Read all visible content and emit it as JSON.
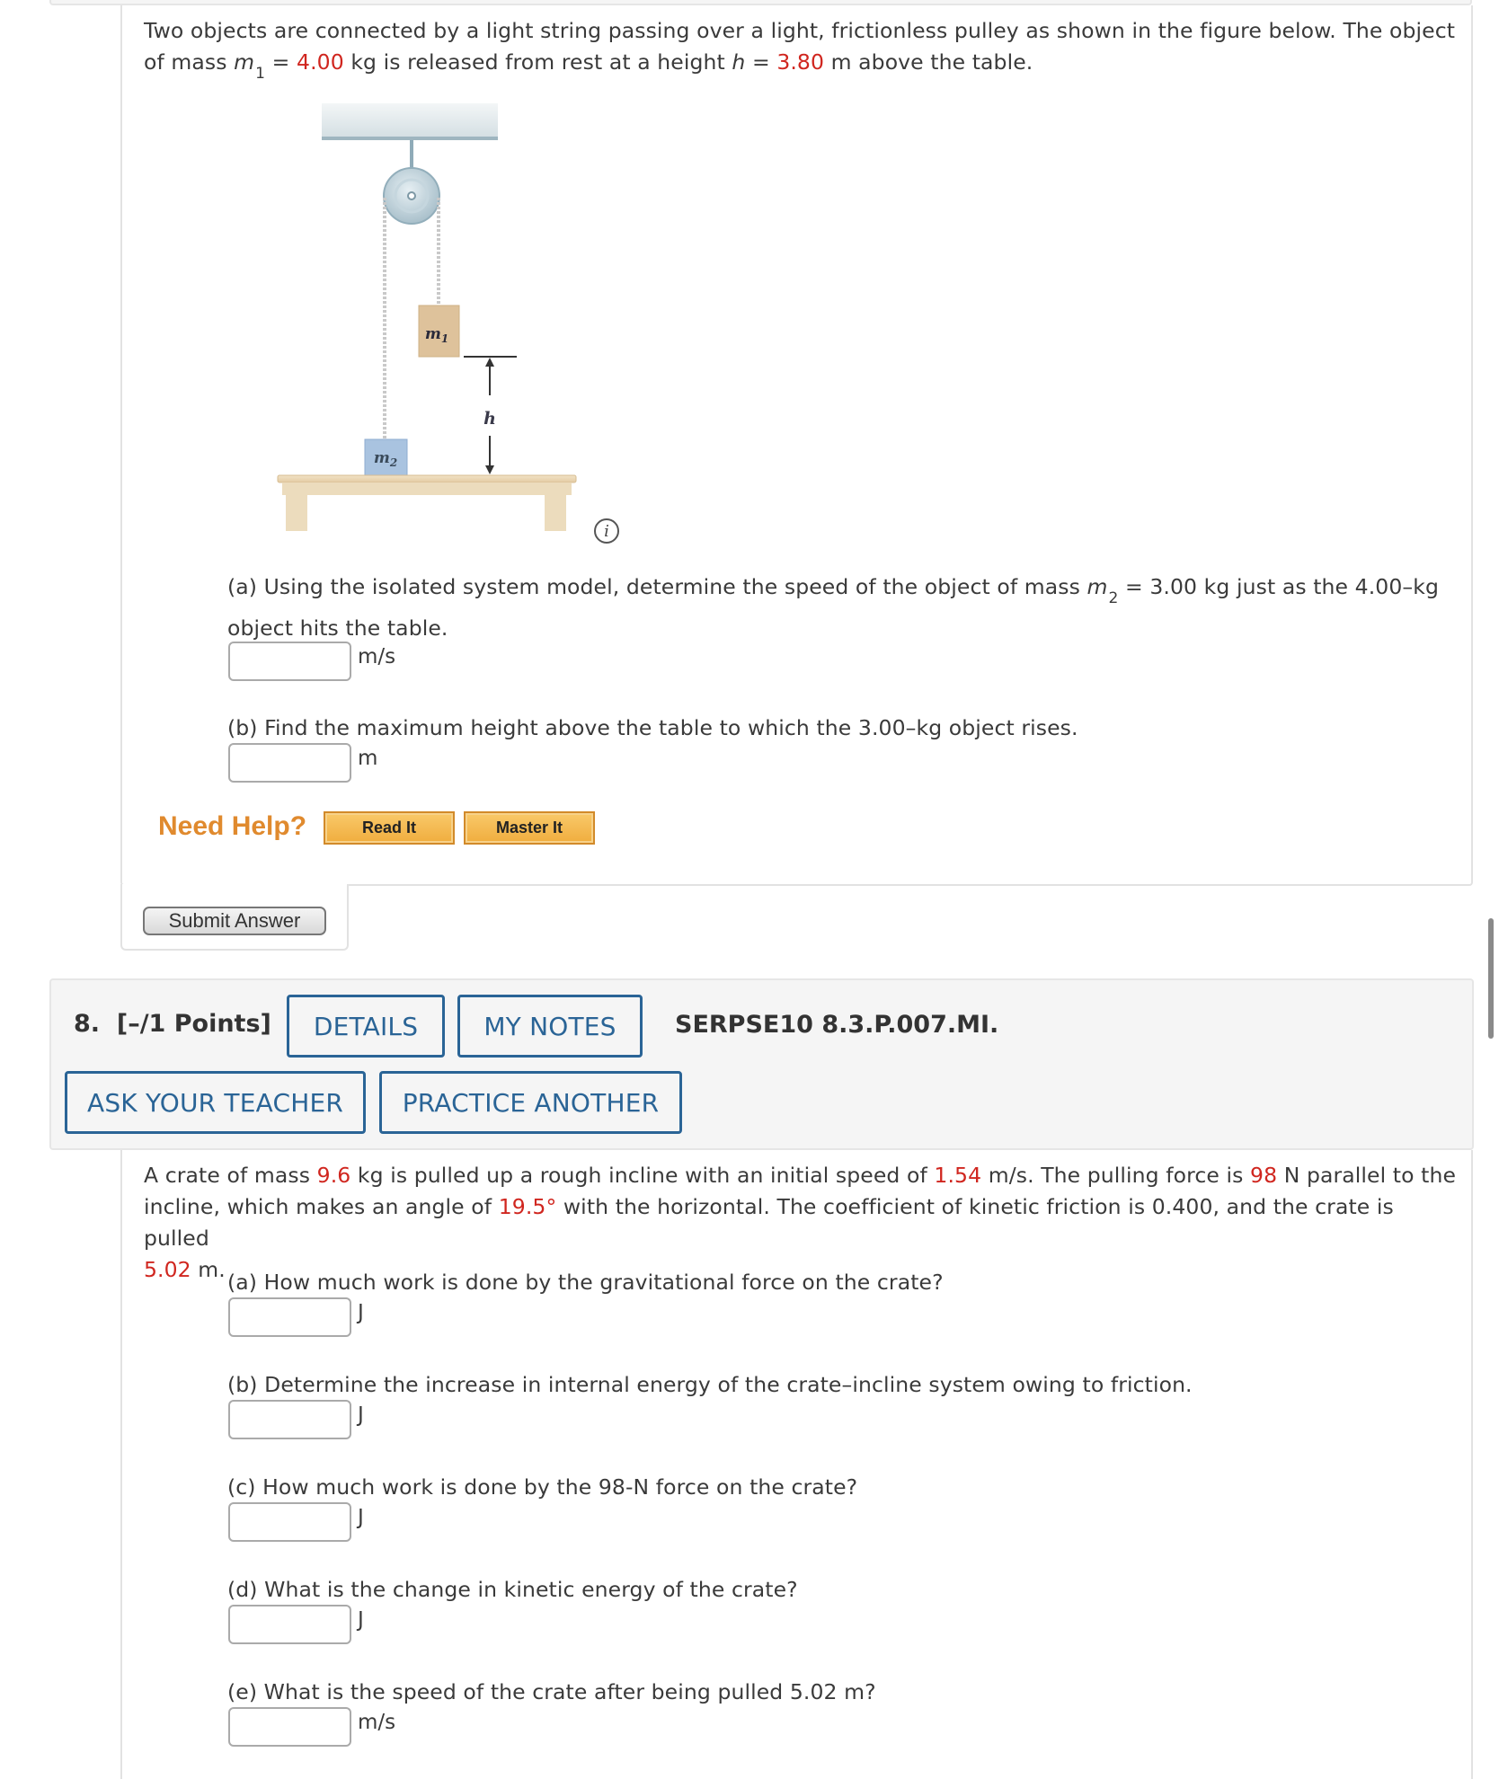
{
  "question7": {
    "intro": {
      "p1": "Two objects are connected by a light string passing over a light, frictionless pulley as shown in the figure below. The object",
      "p2_a": "of mass ",
      "m1_var": "m",
      "m1_sub": "1",
      "p2_b": " = ",
      "m1_value": "4.00",
      "p2_c": " kg is released from rest at a height ",
      "h_var": "h",
      "p2_d": " = ",
      "h_value": "3.80",
      "p2_e": " m above the table."
    },
    "figure": {
      "m1_label": "m",
      "m1_sub": "1",
      "m2_label": "m",
      "m2_sub": "2",
      "h_label": "h",
      "info_icon": "info-icon",
      "info_glyph": "i"
    },
    "parts": [
      {
        "text_a": "(a) Using the isolated system model, determine the speed of the object of mass ",
        "var": "m",
        "sub": "2",
        "text_b": " = 3.00 kg just as the 4.00–kg",
        "text_c": "object hits the table.",
        "unit": "m/s",
        "value": ""
      },
      {
        "text_a": "(b) Find the maximum height above the table to which the 3.00–kg object rises.",
        "unit": "m",
        "value": ""
      }
    ],
    "help": {
      "label": "Need Help?",
      "read_it": "Read It",
      "master_it": "Master It"
    },
    "submit_label": "Submit Answer"
  },
  "question8": {
    "number": "8.",
    "points": "[–/1 Points]",
    "details_label": "DETAILS",
    "notes_label": "MY NOTES",
    "code": "SERPSE10 8.3.P.007.MI.",
    "ask_label": "ASK YOUR TEACHER",
    "practice_label": "PRACTICE ANOTHER",
    "intro": {
      "a": "A crate of mass ",
      "mass": "9.6",
      "b": " kg is pulled up a rough incline with an initial speed of ",
      "speed": "1.54",
      "c": " m/s. The pulling force is ",
      "force": "98",
      "d": " N parallel to the",
      "e": "incline, which makes an angle of ",
      "angle": "19.5°",
      "f": " with the horizontal. The coefficient of kinetic friction is 0.400, and the crate is pulled",
      "distance": "5.02",
      "g": " m."
    },
    "parts": [
      {
        "text": "(a) How much work is done by the gravitational force on the crate?",
        "unit": "J",
        "value": ""
      },
      {
        "text": "(b) Determine the increase in internal energy of the crate–incline system owing to friction.",
        "unit": "J",
        "value": ""
      },
      {
        "text": "(c) How much work is done by the 98-N force on the crate?",
        "unit": "J",
        "value": ""
      },
      {
        "text": "(d) What is the change in kinetic energy of the crate?",
        "unit": "J",
        "value": ""
      },
      {
        "text": "(e) What is the speed of the crate after being pulled 5.02 m?",
        "unit": "m/s",
        "value": ""
      }
    ]
  },
  "colors": {
    "given_value": "#d0261f",
    "link_blue": "#2a6496",
    "help_orange": "#e08a2e"
  }
}
